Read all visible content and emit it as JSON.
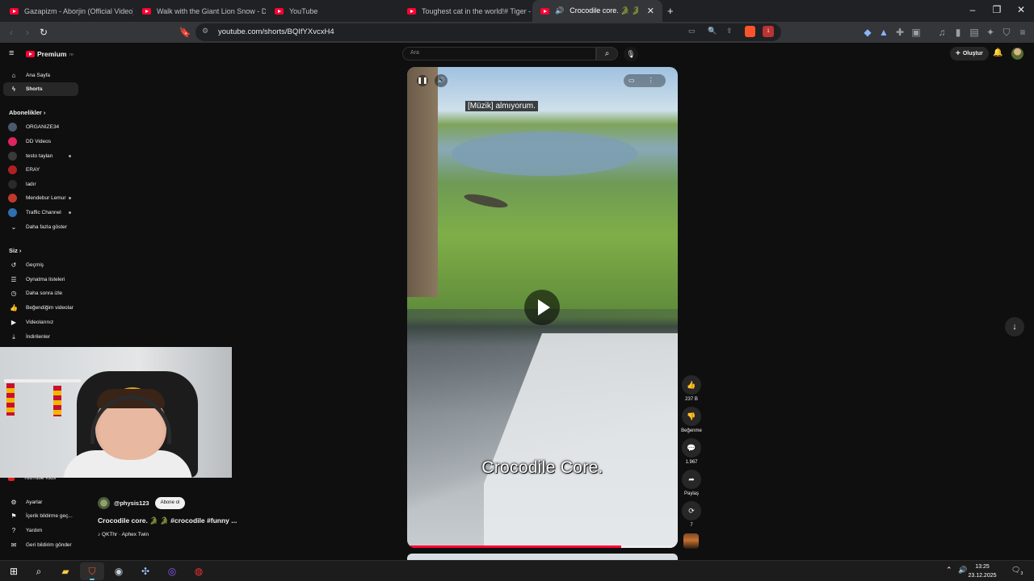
{
  "browser": {
    "tabs": [
      {
        "label": "Gazapizm - Aborjin (Official Video) -",
        "active": false
      },
      {
        "label": "Walk with the Giant Lion Snow - Dea",
        "active": false
      },
      {
        "label": "YouTube",
        "active": false
      },
      {
        "label": "Toughest cat in the world!# Tiger - Yo",
        "active": false
      },
      {
        "label": "Crocodile core. 🐊 🐊 #crocod",
        "active": true
      }
    ],
    "new_tab": "+",
    "url": "youtube.com/shorts/BQIfYXvcxH4",
    "extension_badge": "1"
  },
  "masthead": {
    "logo_text": "Premium",
    "logo_sup": "TR",
    "search_placeholder": "Ara",
    "create_label": "Oluştur"
  },
  "sidebar": {
    "main": [
      {
        "label": "Ana Sayfa",
        "icon": "home-icon"
      },
      {
        "label": "Shorts",
        "icon": "shorts-icon",
        "active": true
      }
    ],
    "subs_title": "Abonelikler",
    "subscriptions": [
      {
        "label": "ORGANIZE34",
        "color": "#4a5a6a"
      },
      {
        "label": "DD Videos",
        "color": "#e0245e"
      },
      {
        "label": "testo taylan",
        "color": "#3a3a3a",
        "live": true
      },
      {
        "label": "ERAY",
        "color": "#b02020"
      },
      {
        "label": "ladır",
        "color": "#2a2a2a"
      },
      {
        "label": "Mendebur Lemur",
        "color": "#c0392b",
        "live": true
      },
      {
        "label": "Traffic Channel",
        "color": "#2f6fb0",
        "live": true
      }
    ],
    "show_more": "Daha fazla göster",
    "you_title": "Siz",
    "you_items": [
      {
        "label": "Geçmiş",
        "icon": "history-icon"
      },
      {
        "label": "Oynatma listeleri",
        "icon": "playlist-icon"
      },
      {
        "label": "Daha sonra izle",
        "icon": "watch-later-icon"
      },
      {
        "label": "Beğendiğim videolar",
        "icon": "like-icon"
      },
      {
        "label": "Videolarınız",
        "icon": "your-videos-icon"
      },
      {
        "label": "İndirilenler",
        "icon": "download-icon"
      }
    ],
    "kids_label": "YouTube Kids",
    "bottom_items": [
      {
        "label": "Ayarlar",
        "icon": "settings-icon"
      },
      {
        "label": "İçerik bildirme geç...",
        "icon": "flag-icon"
      },
      {
        "label": "Yardım",
        "icon": "help-icon"
      },
      {
        "label": "Geri bildirim gönder",
        "icon": "feedback-icon"
      }
    ]
  },
  "player": {
    "caption": "[Müzik] almıyorum.",
    "overlay_title": "Crocodile Core.",
    "progress": 0.79
  },
  "actions": {
    "likes": "237 B",
    "dislike_label": "Beğenme",
    "comments": "1.967",
    "share_label": "Paylaş",
    "remix_count": "7"
  },
  "video_info": {
    "channel": "@physis123",
    "subscribe_label": "Abone ol",
    "title": "Crocodile core. 🐊 🐊 #crocodile #funny ...",
    "music": "♪ QKThr · Aphex Twin"
  },
  "taskbar": {
    "time": "13:25",
    "date": "23.12.2025",
    "notification_count": "3"
  }
}
